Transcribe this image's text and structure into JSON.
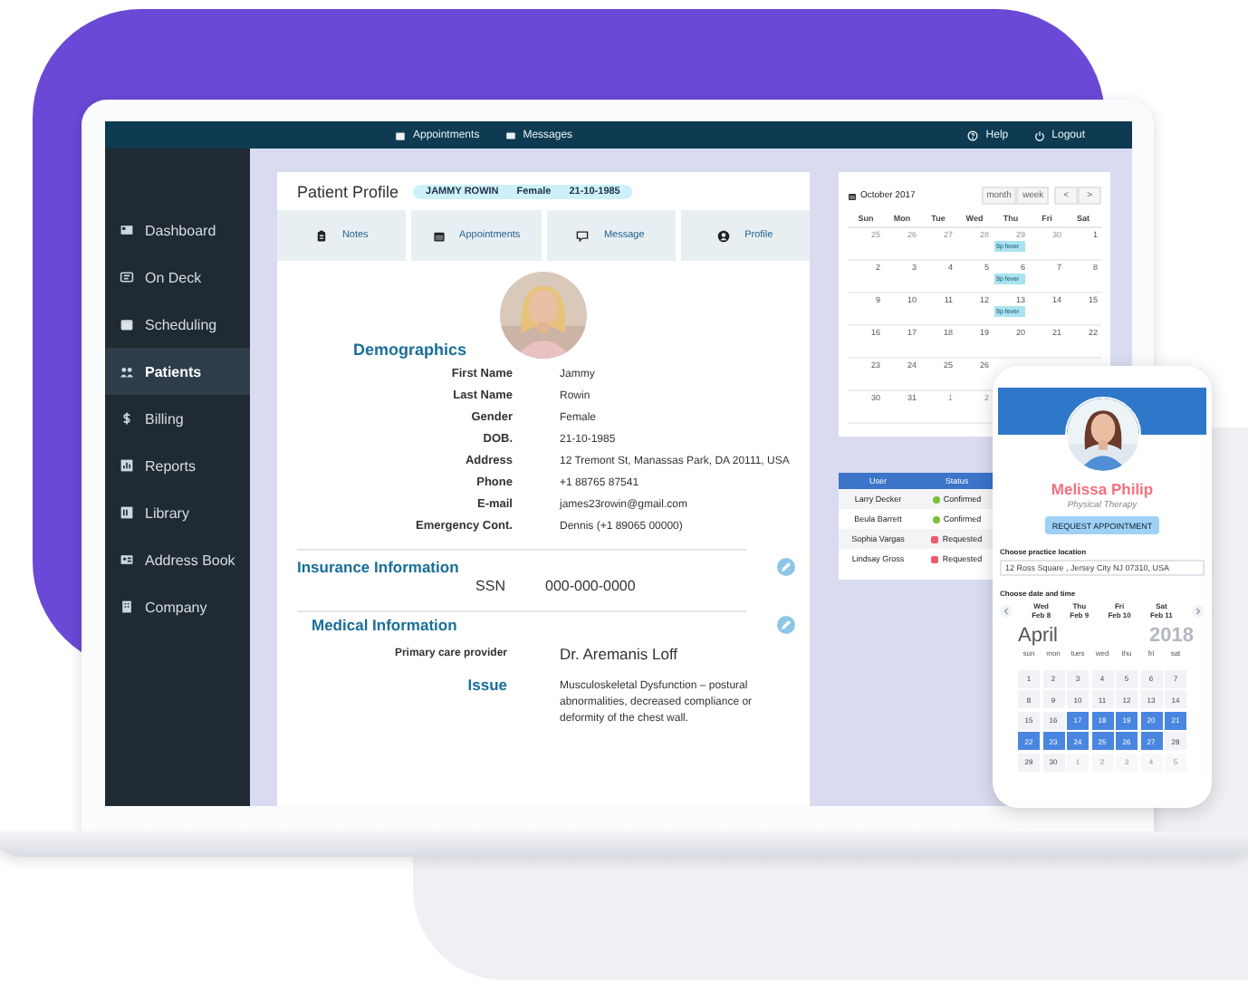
{
  "topbar": {
    "links": [
      {
        "label": "Appointments"
      },
      {
        "label": "Messages"
      }
    ],
    "right_links": [
      {
        "label": "Help"
      },
      {
        "label": "Logout"
      }
    ]
  },
  "sidebar": {
    "items": [
      {
        "label": "Dashboard",
        "selected": false
      },
      {
        "label": "On Deck",
        "selected": false
      },
      {
        "label": "Scheduling",
        "selected": false
      },
      {
        "label": "Patients",
        "selected": true
      },
      {
        "label": "Billing",
        "selected": false
      },
      {
        "label": "Reports",
        "selected": false
      },
      {
        "label": "Library",
        "selected": false
      },
      {
        "label": "Address Book",
        "selected": false
      },
      {
        "label": "Company",
        "selected": false
      }
    ]
  },
  "profile": {
    "title": "Patient Profile",
    "badge": [
      "JAMMY ROWIN",
      "Female",
      "21-10-1985"
    ],
    "tabs": [
      {
        "label": "Notes"
      },
      {
        "label": "Appointments"
      },
      {
        "label": "Message"
      },
      {
        "label": "Profile"
      }
    ],
    "demographics": {
      "heading": "Demographics",
      "fields": [
        {
          "label": "First Name",
          "value": "Jammy"
        },
        {
          "label": "Last Name",
          "value": "Rowin"
        },
        {
          "label": "Gender",
          "value": "Female"
        },
        {
          "label": "DOB.",
          "value": "21-10-1985"
        },
        {
          "label": "Address",
          "value": "12 Tremont St, Manassas Park, DA 20111, USA"
        },
        {
          "label": "Phone",
          "value": "+1 88765 87541"
        },
        {
          "label": "E-mail",
          "value": "james23rowin@gmail.com"
        },
        {
          "label": "Emergency Cont.",
          "value": "Dennis (+1 89065 00000)"
        }
      ]
    },
    "insurance": {
      "heading": "Insurance Information",
      "fields": [
        {
          "label": "SSN",
          "value": "000-000-0000"
        }
      ]
    },
    "medical": {
      "heading": "Medical Information",
      "provider": {
        "label": "Primary care provider",
        "value": "Dr.  Aremanis Loff"
      },
      "issue": {
        "label": "Issue",
        "value": "Musculoskeletal Dysfunction – postural abnormalities, decreased compliance or deformity of the chest wall."
      }
    }
  },
  "calendar": {
    "title": "October 2017",
    "views": [
      "month",
      "week"
    ],
    "nav": [
      "<",
      ">"
    ],
    "weekdays": [
      "Sun",
      "Mon",
      "Tue",
      "Wed",
      "Thu",
      "Fri",
      "Sat"
    ],
    "weeks": [
      [
        {
          "day": "25",
          "muted": true
        },
        {
          "day": "26",
          "muted": true
        },
        {
          "day": "27",
          "muted": true
        },
        {
          "day": "28",
          "muted": true
        },
        {
          "day": "29",
          "muted": true,
          "event": "9p fever"
        },
        {
          "day": "30",
          "muted": true
        },
        {
          "day": "1",
          "muted": false
        }
      ],
      [
        {
          "day": "2",
          "muted": false
        },
        {
          "day": "3",
          "muted": false
        },
        {
          "day": "4",
          "muted": false
        },
        {
          "day": "5",
          "muted": false
        },
        {
          "day": "6",
          "muted": false,
          "event": "9p fever"
        },
        {
          "day": "7",
          "muted": false
        },
        {
          "day": "8",
          "muted": false
        }
      ],
      [
        {
          "day": "9",
          "muted": false
        },
        {
          "day": "10",
          "muted": false
        },
        {
          "day": "11",
          "muted": false
        },
        {
          "day": "12",
          "muted": false
        },
        {
          "day": "13",
          "muted": false,
          "event": "9p fever"
        },
        {
          "day": "14",
          "muted": false
        },
        {
          "day": "15",
          "muted": false
        }
      ],
      [
        {
          "day": "16",
          "muted": false
        },
        {
          "day": "17",
          "muted": false
        },
        {
          "day": "18",
          "muted": false
        },
        {
          "day": "19",
          "muted": false
        },
        {
          "day": "20",
          "muted": false
        },
        {
          "day": "21",
          "muted": false
        },
        {
          "day": "22",
          "muted": false
        }
      ],
      [
        {
          "day": "23",
          "muted": false
        },
        {
          "day": "24",
          "muted": false
        },
        {
          "day": "25",
          "muted": false
        },
        {
          "day": "26",
          "muted": false
        }
      ],
      [
        {
          "day": "30",
          "muted": false
        },
        {
          "day": "31",
          "muted": false
        },
        {
          "day": "1",
          "muted": true
        },
        {
          "day": "2",
          "muted": true
        }
      ]
    ]
  },
  "users_table": {
    "columns": [
      "User",
      "Status"
    ],
    "rows": [
      {
        "user": "Larry Decker",
        "status": "Confirmed",
        "kind": "confirmed"
      },
      {
        "user": "Beula Barrett",
        "status": "Confirmed",
        "kind": "confirmed"
      },
      {
        "user": "Sophia Vargas",
        "status": "Requested",
        "kind": "requested"
      },
      {
        "user": "Lindsay Gross",
        "status": "Requested",
        "kind": "requested"
      }
    ]
  },
  "phone": {
    "name": "Melissa Philip",
    "specialty": "Physical Therapy",
    "button": "REQUEST APPOINTMENT",
    "location_label": "Choose practice location",
    "location": "12 Ross Square , Jersey City NJ 07310, USA",
    "date_label": "Choose date and time",
    "days": [
      {
        "weekday": "Wed",
        "date": "Feb 8"
      },
      {
        "weekday": "Thu",
        "date": "Feb 9"
      },
      {
        "weekday": "Fri",
        "date": "Feb 10"
      },
      {
        "weekday": "Sat",
        "date": "Feb 11"
      }
    ],
    "month": "April",
    "year": "2018",
    "weekdays": [
      "sun",
      "mon",
      "tues",
      "wed",
      "thu",
      "fri",
      "sat"
    ],
    "weeks": [
      [
        {
          "day": "1",
          "selected": false,
          "muted": false
        },
        {
          "day": "2",
          "selected": false,
          "muted": false
        },
        {
          "day": "3",
          "selected": false,
          "muted": false
        },
        {
          "day": "4",
          "selected": false,
          "muted": false
        },
        {
          "day": "5",
          "selected": false,
          "muted": false
        },
        {
          "day": "6",
          "selected": false,
          "muted": false
        },
        {
          "day": "7",
          "selected": false,
          "muted": false
        }
      ],
      [
        {
          "day": "8",
          "selected": false,
          "muted": false
        },
        {
          "day": "9",
          "selected": false,
          "muted": false
        },
        {
          "day": "10",
          "selected": false,
          "muted": false
        },
        {
          "day": "11",
          "selected": false,
          "muted": false
        },
        {
          "day": "12",
          "selected": false,
          "muted": false
        },
        {
          "day": "13",
          "selected": false,
          "muted": false
        },
        {
          "day": "14",
          "selected": false,
          "muted": false
        }
      ],
      [
        {
          "day": "15",
          "selected": false,
          "muted": false
        },
        {
          "day": "16",
          "selected": false,
          "muted": false
        },
        {
          "day": "17",
          "selected": true,
          "muted": false
        },
        {
          "day": "18",
          "selected": true,
          "muted": false
        },
        {
          "day": "19",
          "selected": true,
          "muted": false
        },
        {
          "day": "20",
          "selected": true,
          "muted": false
        },
        {
          "day": "21",
          "selected": true,
          "muted": false
        }
      ],
      [
        {
          "day": "22",
          "selected": true,
          "muted": false
        },
        {
          "day": "23",
          "selected": true,
          "muted": false
        },
        {
          "day": "24",
          "selected": true,
          "muted": false
        },
        {
          "day": "25",
          "selected": true,
          "muted": false
        },
        {
          "day": "26",
          "selected": true,
          "muted": false
        },
        {
          "day": "27",
          "selected": true,
          "muted": false
        },
        {
          "day": "28",
          "selected": false,
          "muted": false
        }
      ],
      [
        {
          "day": "29",
          "selected": false,
          "muted": false
        },
        {
          "day": "30",
          "selected": false,
          "muted": false
        },
        {
          "day": "1",
          "selected": false,
          "muted": true
        },
        {
          "day": "2",
          "selected": false,
          "muted": true
        },
        {
          "day": "3",
          "selected": false,
          "muted": true
        },
        {
          "day": "4",
          "selected": false,
          "muted": true
        },
        {
          "day": "5",
          "selected": false,
          "muted": true
        }
      ]
    ]
  }
}
